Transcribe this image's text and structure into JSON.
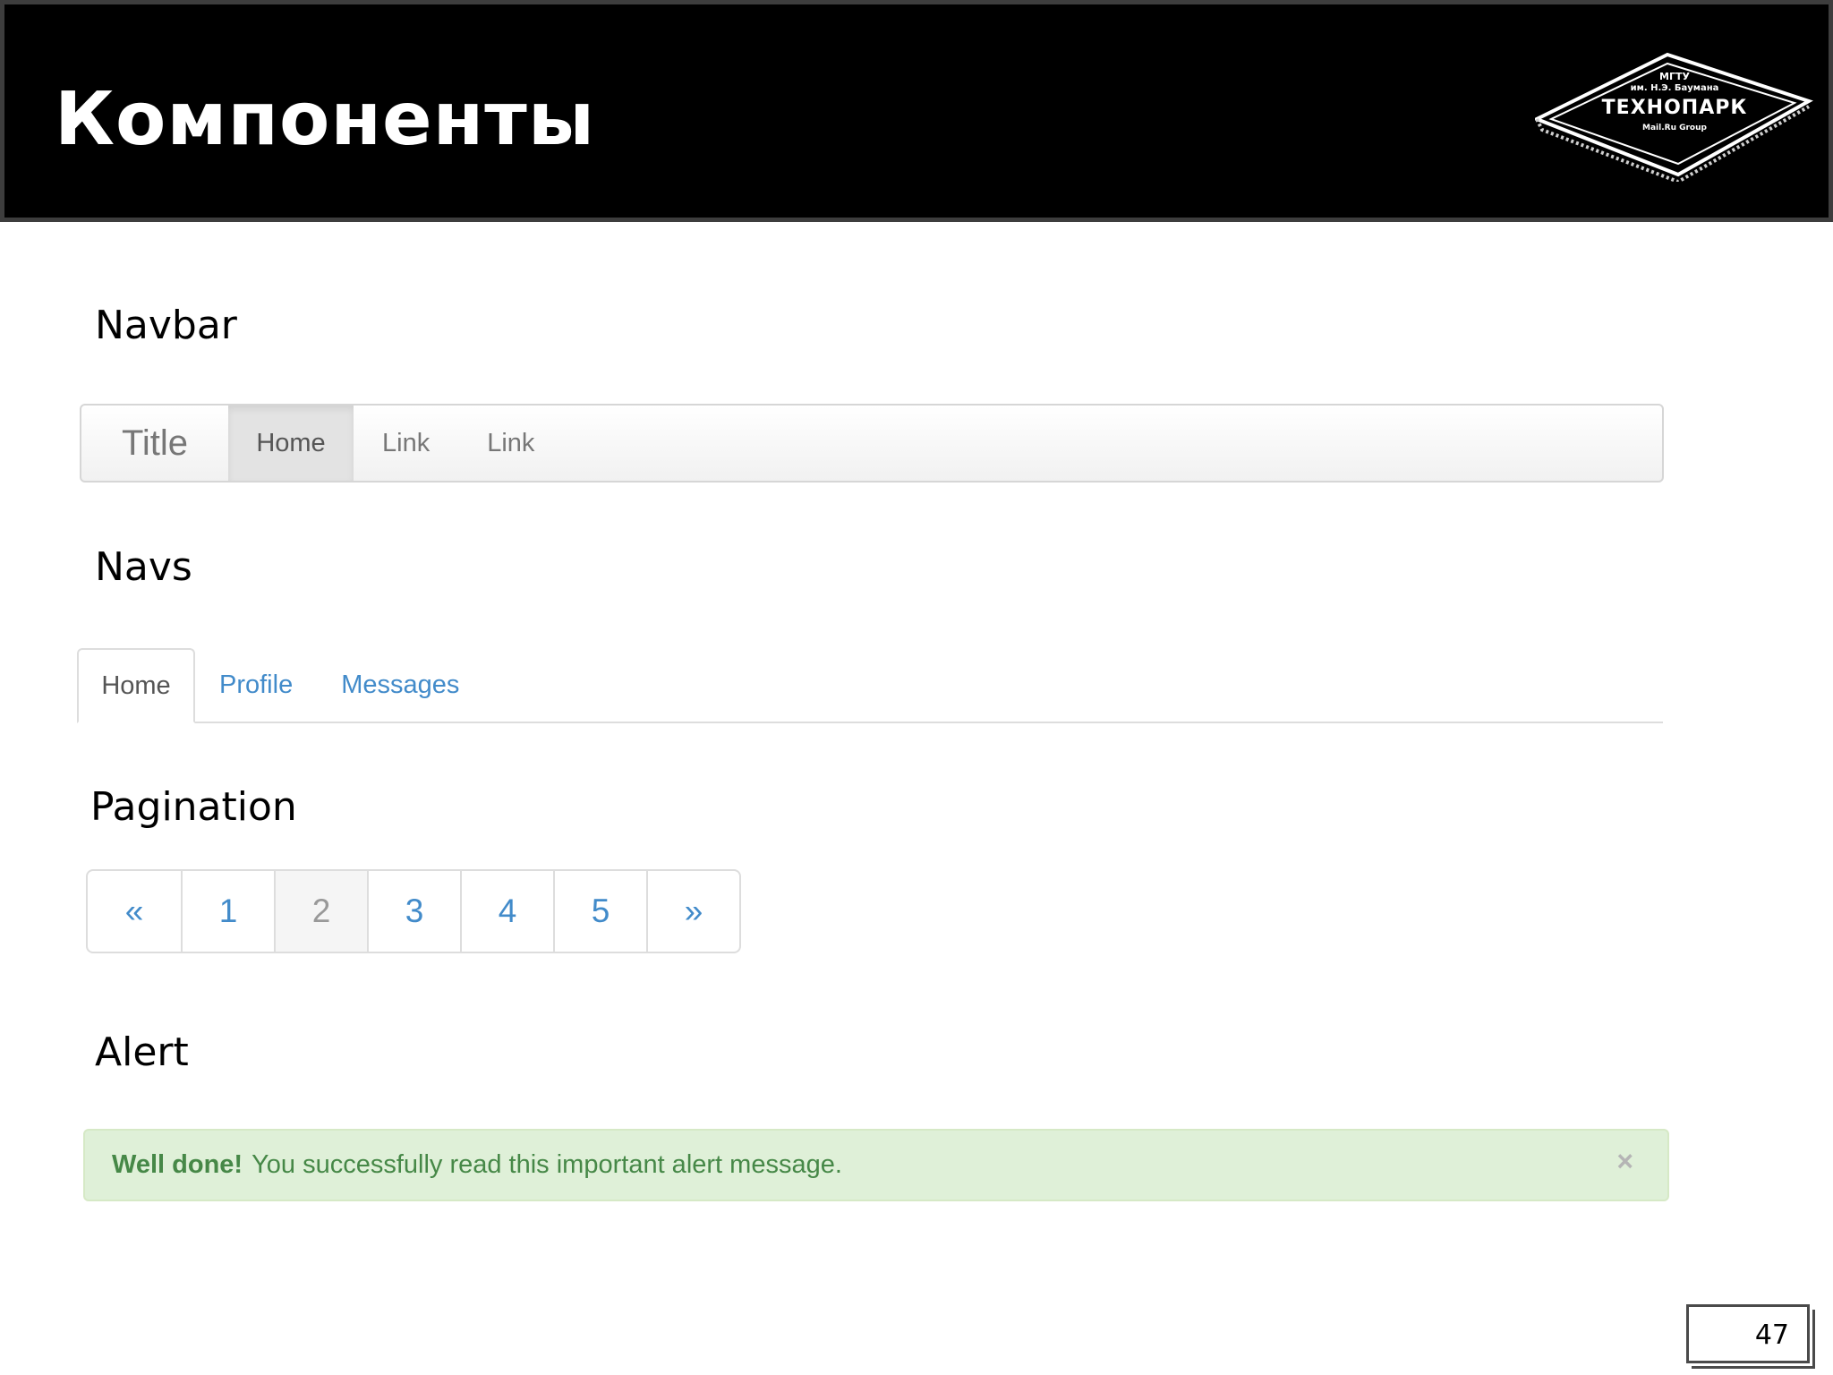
{
  "header": {
    "title": "Компоненты",
    "logo": {
      "line1": "МГТУ",
      "line2": "им. Н.Э. Баумана",
      "line3": "ТЕХНОПАРК",
      "line4": "Mail.Ru Group"
    }
  },
  "sections": {
    "navbar": {
      "heading": "Navbar",
      "brand": "Title",
      "items": [
        {
          "label": "Home",
          "active": true
        },
        {
          "label": "Link",
          "active": false
        },
        {
          "label": "Link",
          "active": false
        }
      ]
    },
    "navs": {
      "heading": "Navs",
      "tabs": [
        {
          "label": "Home",
          "active": true
        },
        {
          "label": "Profile",
          "active": false
        },
        {
          "label": "Messages",
          "active": false
        }
      ]
    },
    "pagination": {
      "heading": "Pagination",
      "items": [
        {
          "label": "«",
          "active": false
        },
        {
          "label": "1",
          "active": false
        },
        {
          "label": "2",
          "active": true
        },
        {
          "label": "3",
          "active": false
        },
        {
          "label": "4",
          "active": false
        },
        {
          "label": "5",
          "active": false
        },
        {
          "label": "»",
          "active": false
        }
      ]
    },
    "alert": {
      "heading": "Alert",
      "strong": "Well done!",
      "message": "You successfully read this important alert message.",
      "close": "×",
      "color": "#468847",
      "background": "#dff0d8"
    }
  },
  "page_number": "47",
  "colors": {
    "link": "#428bca",
    "header_bg": "#000000"
  }
}
